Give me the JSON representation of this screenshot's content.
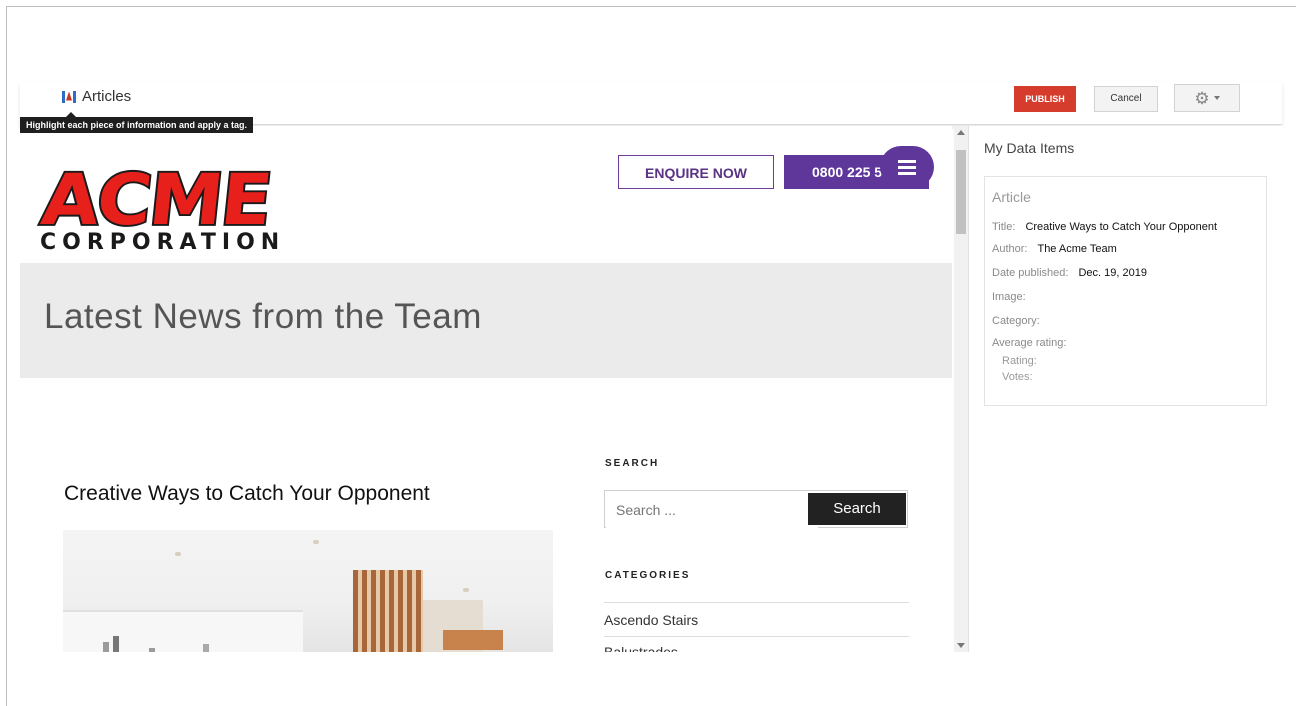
{
  "toolbar": {
    "title": "Articles",
    "tooltip": "Highlight each piece of information and apply a tag.",
    "publish_label": "PUBLISH",
    "cancel_label": "Cancel",
    "settings_icon": "gear-icon"
  },
  "site": {
    "logo_word": "ACME",
    "logo_sub": "CORPORATION",
    "enquire_label": "ENQUIRE NOW",
    "phone_label": "0800 225 5",
    "hero_title": "Latest News from the Team",
    "article_title": "Creative Ways to Catch Your Opponent",
    "search_heading": "SEARCH",
    "search_placeholder": "Search ...",
    "search_button": "Search",
    "categories_heading": "CATEGORIES",
    "categories": [
      "Ascendo Stairs",
      "Balustrades"
    ]
  },
  "panel": {
    "title": "My Data Items",
    "card_title": "Article",
    "fields": {
      "title_label": "Title:",
      "title_value": "Creative Ways to Catch Your Opponent",
      "author_label": "Author:",
      "author_value": "The Acme Team",
      "date_label": "Date published:",
      "date_value": "Dec. 19, 2019",
      "image_label": "Image:",
      "category_label": "Category:",
      "rating_label": "Average rating:",
      "rating_sub": "Rating:",
      "votes_sub": "Votes:"
    }
  },
  "colors": {
    "publish": "#d63c2c",
    "brand_purple": "#5f379b",
    "acme_red": "#e8201c"
  }
}
